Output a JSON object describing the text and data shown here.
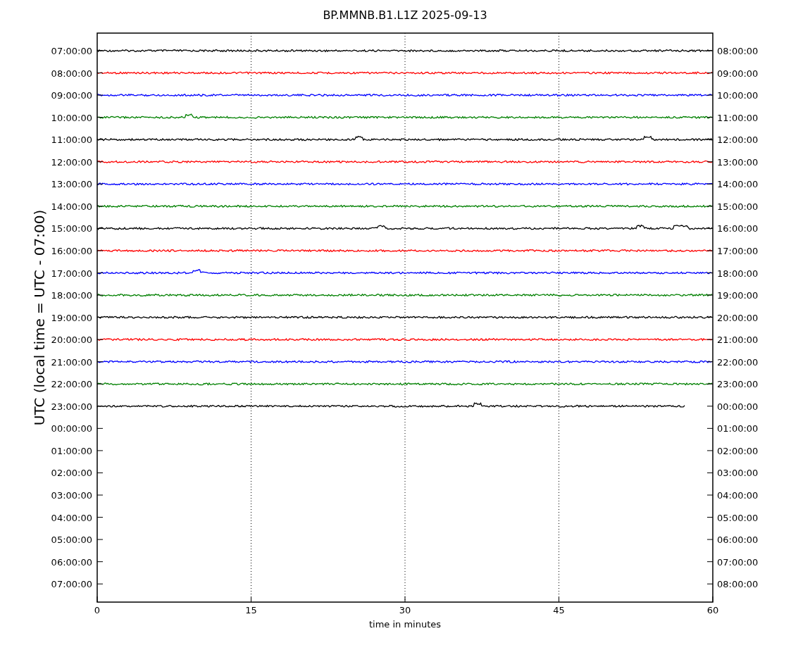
{
  "title": "BP.MMNB.B1.L1Z 2025-09-13",
  "ylabel": "UTC (local time = UTC - 07:00)",
  "xlabel": "time in minutes",
  "xticks": [
    "0",
    "15",
    "30",
    "45",
    "60"
  ],
  "left_ticks": [
    "07:00:00",
    "08:00:00",
    "09:00:00",
    "10:00:00",
    "11:00:00",
    "12:00:00",
    "13:00:00",
    "14:00:00",
    "15:00:00",
    "16:00:00",
    "17:00:00",
    "18:00:00",
    "19:00:00",
    "20:00:00",
    "21:00:00",
    "22:00:00",
    "23:00:00",
    "00:00:00",
    "01:00:00",
    "02:00:00",
    "03:00:00",
    "04:00:00",
    "05:00:00",
    "06:00:00",
    "07:00:00"
  ],
  "right_ticks": [
    "08:00:00",
    "09:00:00",
    "10:00:00",
    "11:00:00",
    "12:00:00",
    "13:00:00",
    "14:00:00",
    "15:00:00",
    "16:00:00",
    "17:00:00",
    "18:00:00",
    "19:00:00",
    "20:00:00",
    "21:00:00",
    "22:00:00",
    "23:00:00",
    "00:00:00",
    "01:00:00",
    "02:00:00",
    "03:00:00",
    "04:00:00",
    "05:00:00",
    "06:00:00",
    "07:00:00",
    "08:00:00"
  ],
  "traces": [
    {
      "color": "#000000",
      "level": 1
    },
    {
      "color": "#ff0000",
      "level": 1
    },
    {
      "color": "#0000ff",
      "level": 1
    },
    {
      "color": "#008000",
      "level": 1
    },
    {
      "color": "#000000",
      "level": 1
    },
    {
      "color": "#ff0000",
      "level": 1
    },
    {
      "color": "#0000ff",
      "level": 1
    },
    {
      "color": "#008000",
      "level": 1
    },
    {
      "color": "#000000",
      "level": 1
    },
    {
      "color": "#ff0000",
      "level": 1
    },
    {
      "color": "#0000ff",
      "level": 1
    },
    {
      "color": "#008000",
      "level": 1
    },
    {
      "color": "#000000",
      "level": 1
    },
    {
      "color": "#ff0000",
      "level": 1
    },
    {
      "color": "#0000ff",
      "level": 1
    },
    {
      "color": "#008000",
      "level": 1
    },
    {
      "color": "#000000",
      "level": 0.955
    }
  ]
}
